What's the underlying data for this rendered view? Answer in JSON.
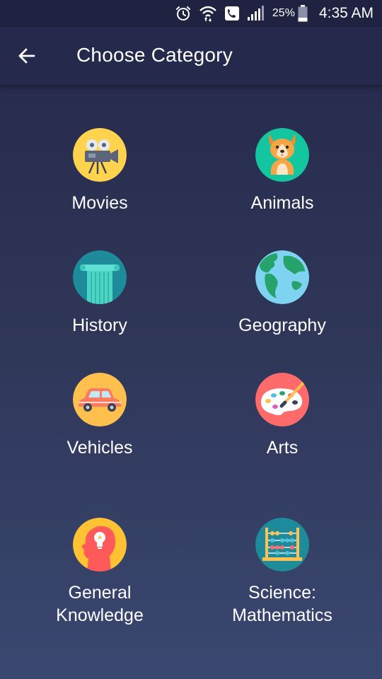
{
  "status_bar": {
    "battery_percent": "25%",
    "time": "4:35 AM",
    "icons": [
      "alarm-icon",
      "wifi-icon",
      "phone-call-icon",
      "signal-icon",
      "battery-icon"
    ]
  },
  "header": {
    "title": "Choose Category",
    "back_icon": "arrow-left-icon"
  },
  "categories": [
    {
      "label": "Movies",
      "icon": "movie-camera-icon",
      "color": "#ffd34e"
    },
    {
      "label": "Animals",
      "icon": "dog-icon",
      "color": "#13c6a0"
    },
    {
      "label": "History",
      "icon": "column-icon",
      "color": "#1d8b9a"
    },
    {
      "label": "Geography",
      "icon": "globe-icon",
      "color": "#7dd3f0"
    },
    {
      "label": "Vehicles",
      "icon": "car-icon",
      "color": "#ffc04d"
    },
    {
      "label": "Arts",
      "icon": "paint-palette-icon",
      "color": "#ff6b6b"
    },
    {
      "label": "General\nKnowledge",
      "icon": "head-lightbulb-icon",
      "color": "#ffc233"
    },
    {
      "label": "Science:\nMathematics",
      "icon": "abacus-icon",
      "color": "#1d8b9a"
    }
  ]
}
